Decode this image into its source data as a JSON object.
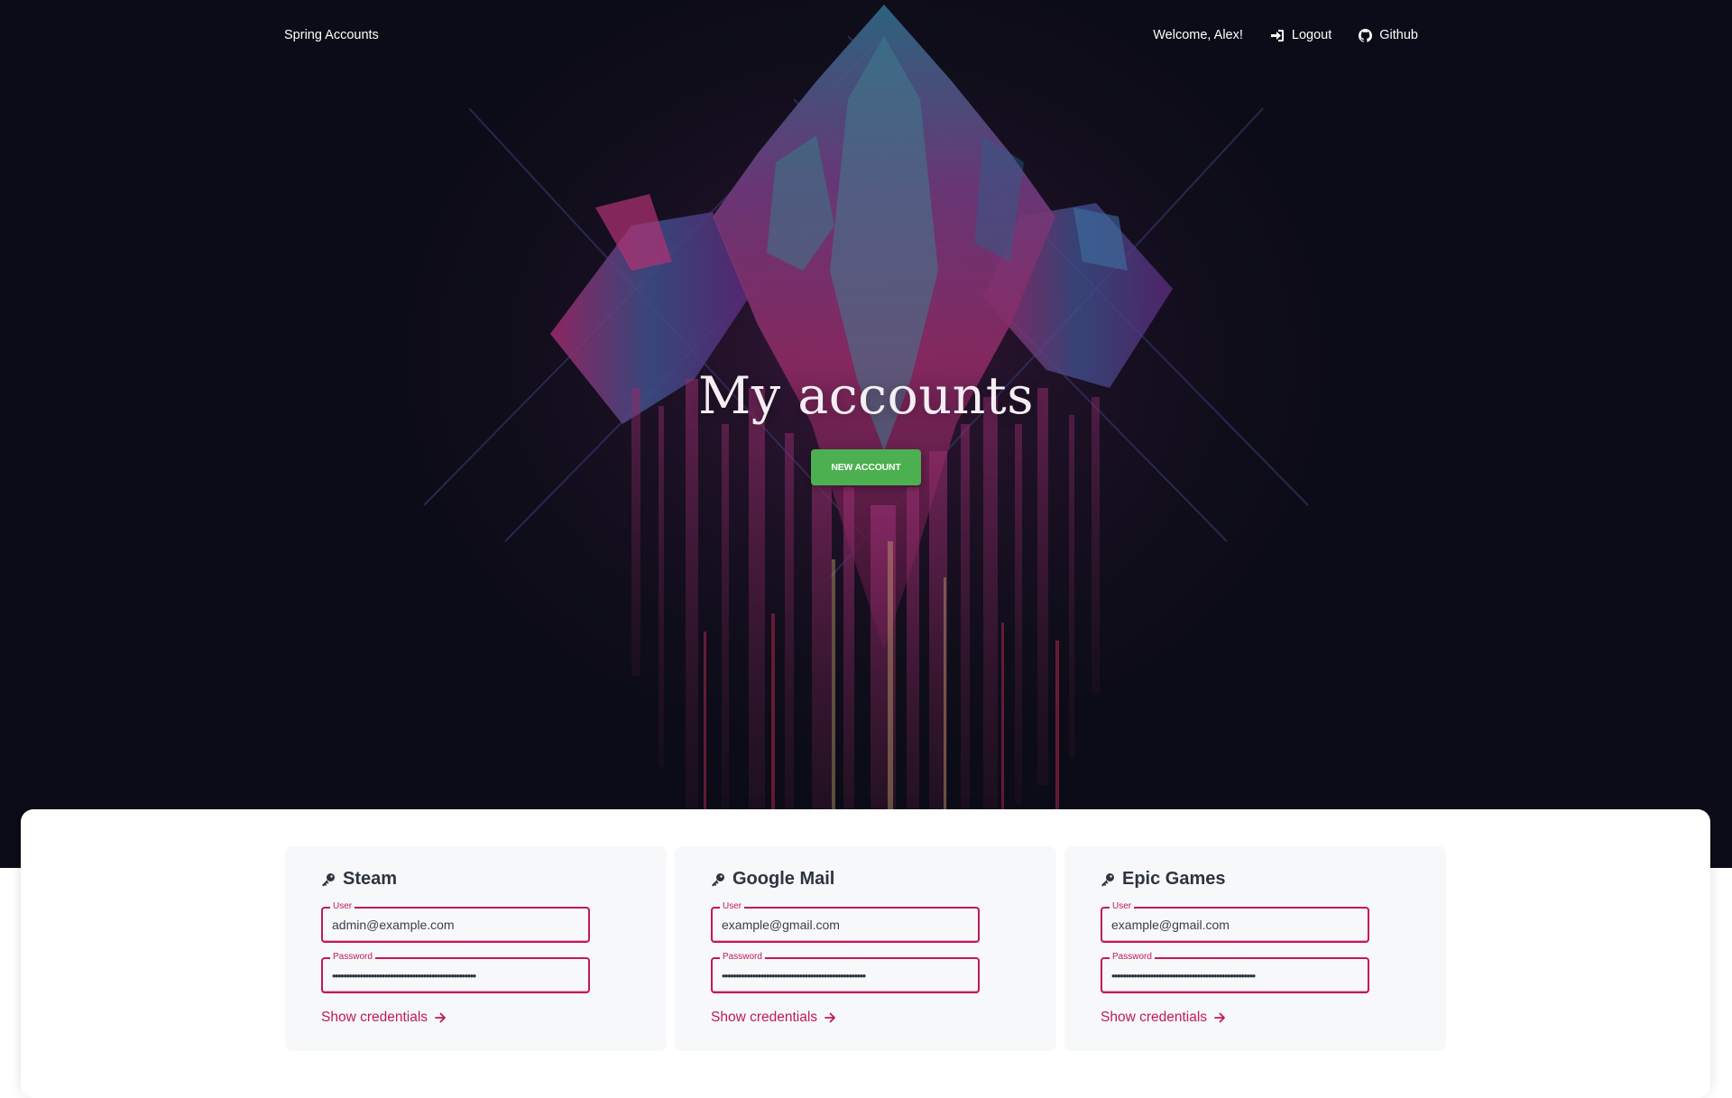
{
  "navbar": {
    "brand": "Spring Accounts",
    "welcome": "Welcome, Alex!",
    "logout_label": "Logout",
    "github_label": "Github"
  },
  "hero": {
    "title": "My accounts",
    "new_account_label": "NEW ACCOUNT"
  },
  "accounts": [
    {
      "name": "Steam",
      "user_label": "User",
      "user_value": "admin@example.com",
      "password_label": "Password",
      "password_value": "••••••••••••••••••••••••••••••••••••••••••••••••••••",
      "show_label": "Show credentials"
    },
    {
      "name": "Google Mail",
      "user_label": "User",
      "user_value": "example@gmail.com",
      "password_label": "Password",
      "password_value": "••••••••••••••••••••••••••••••••••••••••••••••••••••",
      "show_label": "Show credentials"
    },
    {
      "name": "Epic Games",
      "user_label": "User",
      "user_value": "example@gmail.com",
      "password_label": "Password",
      "password_value": "••••••••••••••••••••••••••••••••••••••••••••••••••••",
      "show_label": "Show credentials"
    }
  ],
  "icons": {
    "logout": "sign-in-icon",
    "github": "github-icon",
    "account": "key-icon",
    "show": "arrow-right-icon"
  },
  "colors": {
    "accent": "#c2185b",
    "button": "#4caf50",
    "hero_bg": "#0b0c17",
    "card_bg": "#f7f8fa"
  }
}
